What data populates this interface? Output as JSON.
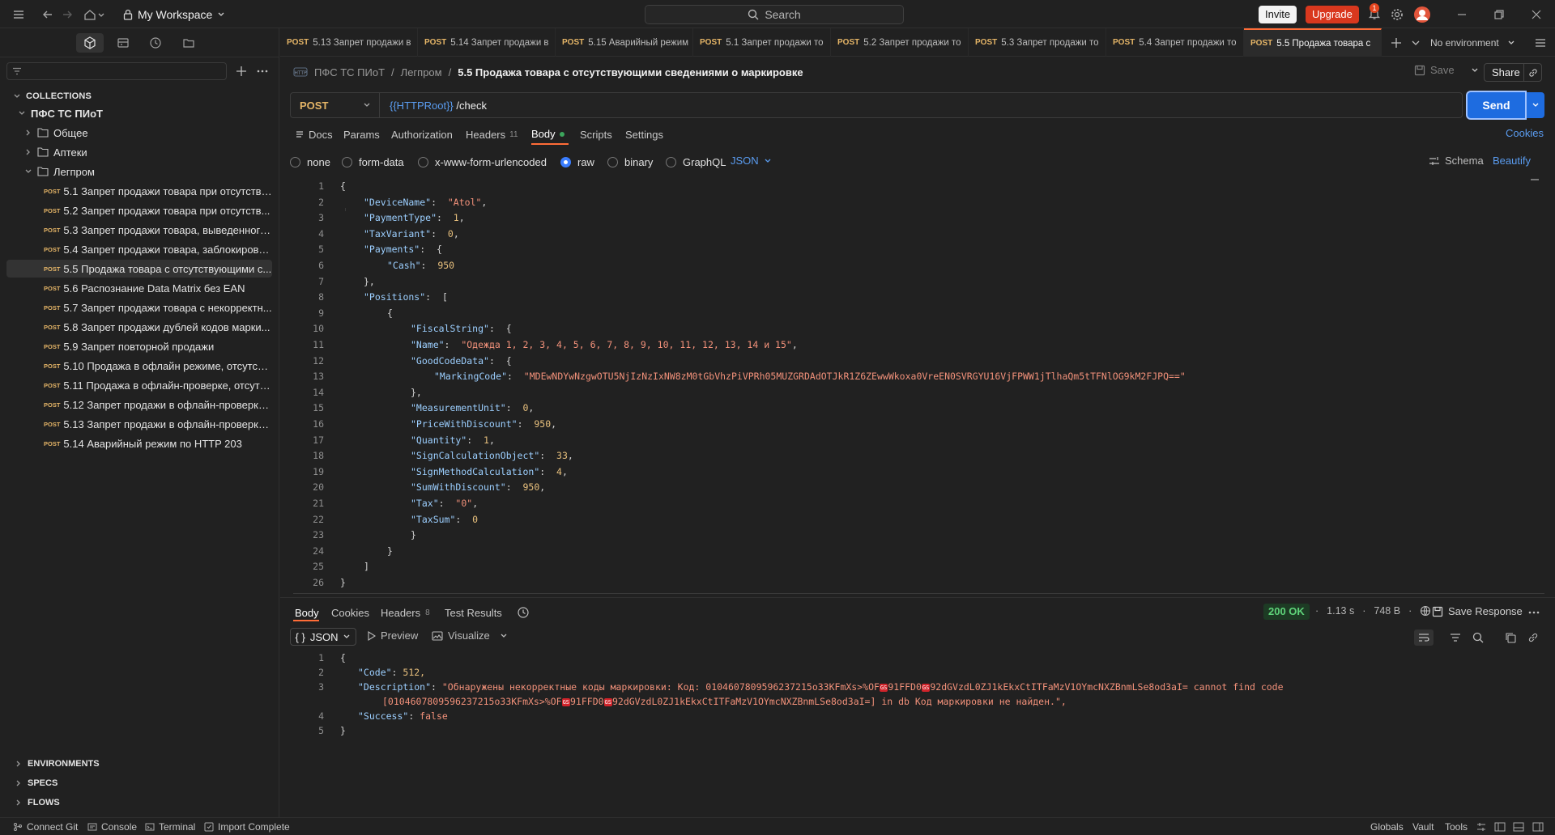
{
  "titlebar": {
    "workspace": "My Workspace",
    "search": "Search",
    "invite": "Invite",
    "upgrade": "Upgrade",
    "notifications_count": "1"
  },
  "sidebar": {
    "collections_header": "COLLECTIONS",
    "collection_name": "ПФС ТС ПИоТ",
    "folders": [
      "Общее",
      "Аптеки",
      "Легпром"
    ],
    "requests": [
      {
        "method": "POST",
        "label": "5.1 Запрет продажи товара при отсутстви..."
      },
      {
        "method": "POST",
        "label": "5.2 Запрет продажи товара при отсутств..."
      },
      {
        "method": "POST",
        "label": "5.3 Запрет продажи товара, выведенного..."
      },
      {
        "method": "POST",
        "label": "5.4 Запрет продажи товара, заблокирова..."
      },
      {
        "method": "POST",
        "label": "5.5 Продажа товара с отсутствующими с..."
      },
      {
        "method": "POST",
        "label": "5.6 Распознание Data Matrix без EAN"
      },
      {
        "method": "POST",
        "label": "5.7 Запрет продажи товара с некорректн..."
      },
      {
        "method": "POST",
        "label": "5.8 Запрет продажи дублей кодов марки..."
      },
      {
        "method": "POST",
        "label": "5.9 Запрет повторной продажи"
      },
      {
        "method": "POST",
        "label": "5.10 Продажа в офлайн режиме, отсутств..."
      },
      {
        "method": "POST",
        "label": "5.11 Продажа в офлайн-проверке, отсутст..."
      },
      {
        "method": "POST",
        "label": "5.12 Запрет продажи в офлайн-проверке,..."
      },
      {
        "method": "POST",
        "label": "5.13 Запрет продажи в офлайн-проверке ..."
      },
      {
        "method": "POST",
        "label": "5.14 Аварийный режим по HTTP 203"
      }
    ],
    "bottom_sections": [
      "ENVIRONMENTS",
      "SPECS",
      "FLOWS"
    ]
  },
  "tabs": [
    {
      "method": "POST",
      "label": "5.13 Запрет продажи в"
    },
    {
      "method": "POST",
      "label": "5.14 Запрет продажи в"
    },
    {
      "method": "POST",
      "label": "5.15 Аварийный режим"
    },
    {
      "method": "POST",
      "label": "5.1 Запрет продажи то"
    },
    {
      "method": "POST",
      "label": "5.2 Запрет продажи то"
    },
    {
      "method": "POST",
      "label": "5.3 Запрет продажи то"
    },
    {
      "method": "POST",
      "label": "5.4 Запрет продажи то"
    },
    {
      "method": "POST",
      "label": "5.5 Продажа товара с"
    }
  ],
  "environment": "No environment",
  "breadcrumb": {
    "collection": "ПФС ТС ПИоТ",
    "folder": "Легпром",
    "current": "5.5 Продажа товара с отсутствующими сведениями о маркировке"
  },
  "save_label": "Save",
  "share_label": "Share",
  "request": {
    "method": "POST",
    "url_var": "{{HTTPRoot}}",
    "url_path": " /check",
    "send": "Send"
  },
  "request_tabs": {
    "docs": "Docs",
    "params": "Params",
    "authorization": "Authorization",
    "headers": "Headers",
    "headers_count": "11",
    "body": "Body",
    "scripts": "Scripts",
    "settings": "Settings",
    "cookies": "Cookies"
  },
  "body_types": {
    "none": "none",
    "form_data": "form-data",
    "urlencoded": "x-www-form-urlencoded",
    "raw": "raw",
    "binary": "binary",
    "graphql": "GraphQL",
    "raw_format": "JSON",
    "schema": "Schema",
    "beautify": "Beautify"
  },
  "request_body_lines": [
    "{",
    "  \"DeviceName\":  \"Atol\",",
    "  \"PaymentType\":  1,",
    "  \"TaxVariant\":  0,",
    "  \"Payments\":  {",
    "    \"Cash\":  950",
    "  },",
    "  \"Positions\":  [",
    "    {",
    "      \"FiscalString\":  {",
    "      \"Name\":  \"Одежда 1, 2, 3, 4, 5, 6, 7, 8, 9, 10, 11, 12, 13, 14 и 15\",",
    "      \"GoodCodeData\":  {",
    "        \"MarkingCode\":  \"MDEwNDYwNzgwOTU5NjIzNzIxNW8zM0tGbVhzPiVPRh05MUZGRDAdOTJkR1Z6ZEwwWkoxa0VreEN0SVRGYU16VjFPWW1jTlhaQm5tTFNlOG9kM2FJPQ==\"",
    "      },",
    "      \"MeasurementUnit\":  0,",
    "      \"PriceWithDiscount\":  950,",
    "      \"Quantity\":  1,",
    "      \"SignCalculationObject\":  33,",
    "      \"SignMethodCalculation\":  4,",
    "      \"SumWithDiscount\":  950,",
    "      \"Tax\":  \"0\",",
    "      \"TaxSum\":  0",
    "      }",
    "    }",
    "  ]",
    "}"
  ],
  "response_tabs": {
    "body": "Body",
    "cookies": "Cookies",
    "headers": "Headers",
    "headers_count": "8",
    "test_results": "Test Results"
  },
  "response_meta": {
    "status": "200 OK",
    "time": "1.13 s",
    "size": "748 B",
    "save_response": "Save Response",
    "format": "JSON",
    "preview": "Preview",
    "visualize": "Visualize"
  },
  "response_body": {
    "l1": "{",
    "code_key": "\"Code\"",
    "code_val": "512,",
    "desc_key": "\"Description\"",
    "desc_a": "\"Обнаружены некорректные коды маркировки: Код: 0104607809596237215o33KFmXs>%OF",
    "desc_b": "91FFD0",
    "desc_c": "92dGVzdL0ZJ1kEkxCtITFaMzV1OYmcNXZBnmLSe8od3aI= cannot find code",
    "desc2_a": "[0104607809596237215o33KFmXs>%OF",
    "desc2_b": "91FFD0",
    "desc2_c": "92dGVzdL0ZJ1kEkxCtITFaMzV1OYmcNXZBnmLSe8od3aI=] in db Код маркировки не найден.\",",
    "ctrl_char": "GS",
    "success_key": "\"Success\"",
    "success_val": "false",
    "l5": "}"
  },
  "statusbar": {
    "connect_git": "Connect Git",
    "console": "Console",
    "terminal": "Terminal",
    "import": "Import Complete",
    "globals": "Globals",
    "vault": "Vault",
    "tools": "Tools"
  }
}
